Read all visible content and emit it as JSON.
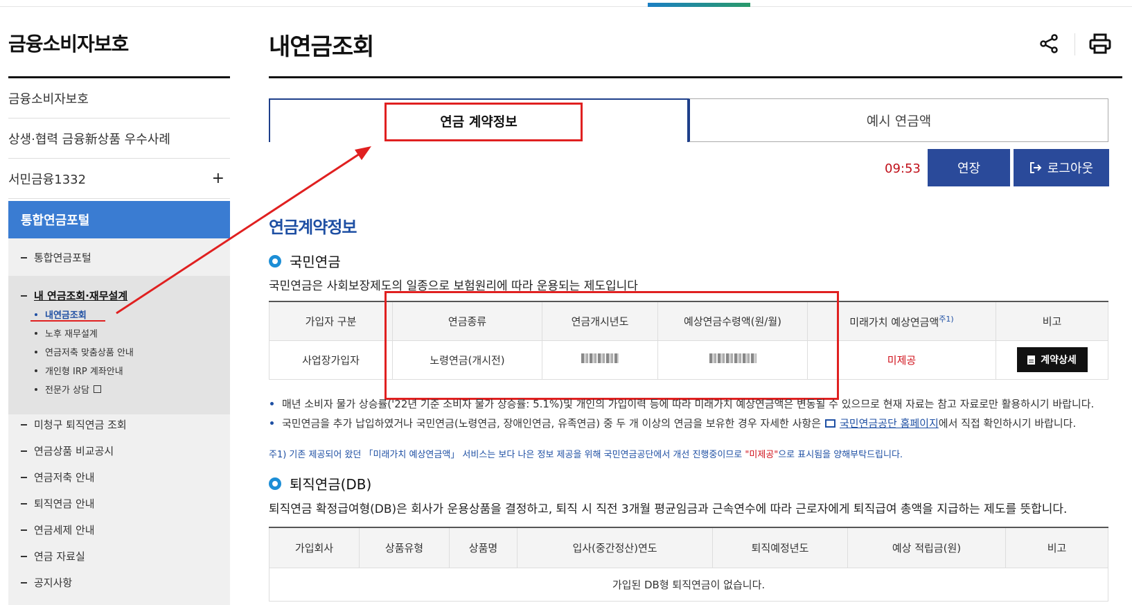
{
  "sidebar": {
    "title": "금융소비자보호",
    "items": [
      {
        "label": "금융소비자보호"
      },
      {
        "label": "상생·협력 금융新상품 우수사례"
      },
      {
        "label": "서민금융1332",
        "toggle": "+"
      }
    ],
    "active": "통합연금포털",
    "subs": {
      "portal": "통합연금포털",
      "my_pension": "내 연금조회·재무설계",
      "leaves": [
        "내연금조회",
        "노후 재무설계",
        "연금저축 맞춤상품 안내",
        "개인형 IRP 계좌안내",
        "전문가 상담"
      ],
      "rest": [
        "미청구 퇴직연금 조회",
        "연금상품 비교공시",
        "연금저축 안내",
        "퇴직연금 안내",
        "연금세제 안내",
        "연금 자료실",
        "공지사항"
      ]
    }
  },
  "header": {
    "title": "내연금조회"
  },
  "tabs": [
    {
      "label": "연금 계약정보"
    },
    {
      "label": "예시 연금액"
    }
  ],
  "session": {
    "timer": "09:53",
    "extend_label": "연장",
    "logout_label": "로그아웃"
  },
  "section": {
    "title": "연금계약정보",
    "national": {
      "heading": "국민연금",
      "desc": "국민연금은 사회보장제도의 일종으로 보험원리에 따라 운용되는 제도입니다",
      "columns": [
        "가입자 구분",
        "연금종류",
        "연금개시년도",
        "예상연금수령액(원/월)",
        "미래가치 예상연금액",
        "비고"
      ],
      "col5_sup": "주1)",
      "row": {
        "type": "사업장가입자",
        "kind": "노령연금(개시전)",
        "future": "미제공",
        "action": "계약상세"
      },
      "bullets": [
        "매년 소비자 물가 상승률('22년 기준 소비자 물가 상승률: 5.1%)및 개인의 가입이력 등에 따라 미래가치 예상연금액은 변동될 수 있으므로 현재 자료는 참고 자료로만 활용하시기 바랍니다.",
        "국민연금을 추가 납입하였거나 국민연금(노령연금, 장애인연금, 유족연금) 중 두 개 이상의 연금을 보유한 경우 자세한 사항은"
      ],
      "bullet2_link": "국민연금공단 홈페이지",
      "bullet2_tail": "에서 직접 확인하시기 바랍니다.",
      "note_a": "주1) 기존 제공되어 왔던 「미래가치 예상연금액」 서비스는 보다 나은 정보 제공을 위해 국민연금공단에서 개선 진행중이므로 ",
      "note_red": "\"미제공\"",
      "note_b": "으로 표시됨을 양해부탁드립니다."
    },
    "retirement": {
      "heading": "퇴직연금(DB)",
      "desc": "퇴직연금 확정급여형(DB)은 회사가 운용상품을 결정하고, 퇴직 시 직전 3개월 평균임금과 근속연수에 따라 근로자에게 퇴직급여 총액을 지급하는 제도를 뜻합니다.",
      "columns": [
        "가입회사",
        "상품유형",
        "상품명",
        "입사(중간정산)연도",
        "퇴직예정년도",
        "예상 적립금(원)",
        "비고"
      ],
      "empty": "가입된 DB형 퇴직연금이 없습니다."
    }
  },
  "colors": {
    "accent": "#3a7cd2",
    "navy": "#2a4a9a",
    "annotation_red": "#e02020"
  }
}
